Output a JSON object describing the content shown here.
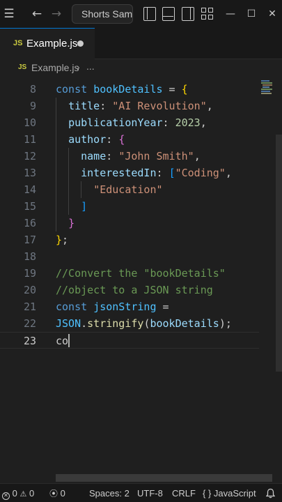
{
  "titlebar": {
    "menu_icon": "☰",
    "back_icon": "←",
    "forward_icon": "→",
    "search_text": "Shorts Sample",
    "minimize_icon": "—",
    "maximize_icon": "☐",
    "close_icon": "✕"
  },
  "tab": {
    "icon_text": "JS",
    "label": "Example.js"
  },
  "breadcrumb": {
    "icon_text": "JS",
    "file": "Example.js",
    "separator": "›",
    "more": "..."
  },
  "editor": {
    "line_numbers": [
      "8",
      "9",
      "10",
      "11",
      "12",
      "13",
      "14",
      "15",
      "16",
      "17",
      "18",
      "19",
      "20",
      "21",
      "22",
      "23"
    ],
    "lines": [
      [
        [
          "kw",
          "const "
        ],
        [
          "var",
          "bookDetails"
        ],
        [
          "txt",
          " = "
        ],
        [
          "b1",
          "{"
        ]
      ],
      [
        [
          "txt",
          "  "
        ],
        [
          "prop",
          "title"
        ],
        [
          "txt",
          ": "
        ],
        [
          "str",
          "\"AI Revolution\""
        ],
        [
          "txt",
          ","
        ]
      ],
      [
        [
          "txt",
          "  "
        ],
        [
          "prop",
          "publicationYear"
        ],
        [
          "txt",
          ": "
        ],
        [
          "num",
          "2023"
        ],
        [
          "txt",
          ","
        ]
      ],
      [
        [
          "txt",
          "  "
        ],
        [
          "prop",
          "author"
        ],
        [
          "txt",
          ": "
        ],
        [
          "b2",
          "{"
        ]
      ],
      [
        [
          "txt",
          "    "
        ],
        [
          "prop",
          "name"
        ],
        [
          "txt",
          ": "
        ],
        [
          "str",
          "\"John Smith\""
        ],
        [
          "txt",
          ","
        ]
      ],
      [
        [
          "txt",
          "    "
        ],
        [
          "prop",
          "interestedIn"
        ],
        [
          "txt",
          ": "
        ],
        [
          "b3",
          "["
        ],
        [
          "str",
          "\"Coding\""
        ],
        [
          "txt",
          ","
        ]
      ],
      [
        [
          "txt",
          "      "
        ],
        [
          "str",
          "\"Education\""
        ]
      ],
      [
        [
          "txt",
          "    "
        ],
        [
          "b3",
          "]"
        ]
      ],
      [
        [
          "txt",
          "  "
        ],
        [
          "b2",
          "}"
        ]
      ],
      [
        [
          "b1",
          "}"
        ],
        [
          "txt",
          ";"
        ]
      ],
      [],
      [
        [
          "cmt",
          "//Convert the \"bookDetails\""
        ]
      ],
      [
        [
          "cmt",
          "//object to a JSON string"
        ]
      ],
      [
        [
          "kw",
          "const "
        ],
        [
          "var",
          "jsonString"
        ],
        [
          "txt",
          " ="
        ]
      ],
      [
        [
          "var",
          "JSON"
        ],
        [
          "txt",
          "."
        ],
        [
          "fn",
          "stringify"
        ],
        [
          "txt",
          "("
        ],
        [
          "prop",
          "bookDetails"
        ],
        [
          "txt",
          ");"
        ]
      ],
      [
        [
          "txt",
          "co"
        ]
      ]
    ]
  },
  "statusbar": {
    "errors": "0",
    "warnings": "0",
    "ports": "0",
    "spaces": "Spaces: 2",
    "encoding": "UTF-8",
    "eol": "CRLF",
    "lang_icon": "{ }",
    "language": "JavaScript"
  },
  "colors": {
    "keyword": "#569cd6",
    "variable": "#4fc1ff",
    "property": "#9cdcfe",
    "string": "#ce9178",
    "number": "#b5cea8",
    "function": "#dcdcaa",
    "comment": "#6a9955",
    "accent": "#0078d4"
  }
}
